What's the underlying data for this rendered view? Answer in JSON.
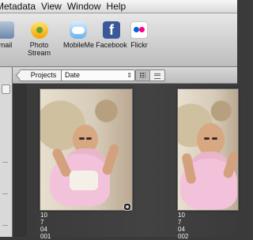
{
  "menu": {
    "items": [
      "Metadata",
      "View",
      "Window",
      "Help"
    ]
  },
  "toolbar": {
    "items": [
      {
        "label": "mail",
        "icon": "email-icon"
      },
      {
        "label": "Photo Stream",
        "icon": "photo-stream-icon"
      },
      {
        "label": "MobileMe",
        "icon": "mobileme-icon"
      },
      {
        "label": "Facebook",
        "icon": "facebook-icon"
      },
      {
        "label": "Flickr",
        "icon": "flickr-icon"
      }
    ]
  },
  "browser": {
    "projects_button": "Projects",
    "sort_value": "Date"
  },
  "photos": [
    {
      "label": "10 7 04 001"
    },
    {
      "label": "10 7 04 002"
    }
  ]
}
